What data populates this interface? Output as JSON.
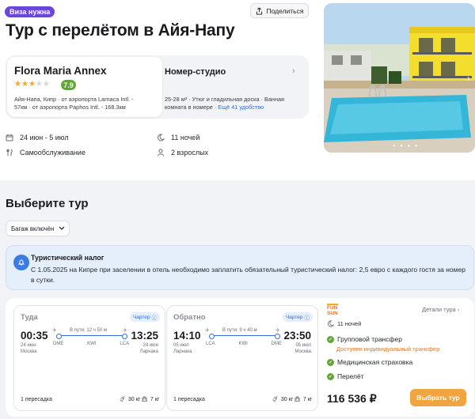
{
  "header": {
    "visa_badge": "Виза нужна",
    "share_label": "Поделиться",
    "title": "Тур с перелётом в Айя-Напу"
  },
  "hotel": {
    "name": "Flora Maria Annex",
    "stars": 3,
    "max_stars": 5,
    "rating": "7.9",
    "location_lines": [
      "Айя-Напа, Кипр  ·  от аэропорта Larnaca Intl. -",
      "57км  ·  от аэропорта Paphos Intl. - 168.3км"
    ]
  },
  "room": {
    "title": "Номер-студио",
    "desc_line1": "25-28 м²  ·  Утюг и гладильная доска  ·  Ванная",
    "desc_line2": "комната в номере  ·  ",
    "more_label": "Ещё 41 удобство"
  },
  "trip_info": {
    "dates": "24 июн - 5 июл",
    "nights": "11 ночей",
    "meal": "Самообслуживание",
    "guests": "2 взрослых"
  },
  "choose_section": {
    "title": "Выберите тур",
    "baggage_filter": "Багаж включён"
  },
  "tax_notice": {
    "title": "Туристический налог",
    "text": "С 1.05.2025 на Кипре при заселении в отель необходимо заплатить обязательный туристический налог: 2,5 евро с каждого гостя за номер в сутки."
  },
  "flights": [
    {
      "direction": "Туда",
      "charter": "Чартер",
      "dep_time": "00:35",
      "dep_date": "24 июн",
      "dep_city": "Москва",
      "arr_time": "13:25",
      "arr_date": "24 июн",
      "arr_city": "Ларнака",
      "duration": "В пути: 12 ч 50 м",
      "codes": [
        "DME",
        "KWI",
        "LCA"
      ],
      "stops": "1 пересадка",
      "bag": "30 кг",
      "hand": "7 кг"
    },
    {
      "direction": "Обратно",
      "charter": "Чартер",
      "dep_time": "14:10",
      "dep_date": "05 июл",
      "dep_city": "Ларнака",
      "arr_time": "23:50",
      "arr_date": "05 июл",
      "arr_city": "Москва",
      "duration": "В пути: 9 ч 40 м",
      "codes": [
        "LCA",
        "KWI",
        "DME"
      ],
      "stops": "1 пересадка",
      "bag": "30 кг",
      "hand": "7 кг"
    }
  ],
  "offer": {
    "operator_line1": "FUN",
    "operator_line2": "SUN",
    "details_label": "Детали тура",
    "nights": "11 ночей",
    "features": [
      "Групповой трансфер",
      "Медицинская страховка",
      "Перелёт"
    ],
    "transfer_note": "Доступен индивидуальный трансфер",
    "price": "116 536 ₽",
    "choose_label": "Выбрать тур"
  },
  "colors": {
    "accent": "#2f6fdc",
    "visa_badge": "#6b47d9",
    "rating": "#5fa832",
    "cta": "#f0a541",
    "operator": "#e1761f"
  }
}
